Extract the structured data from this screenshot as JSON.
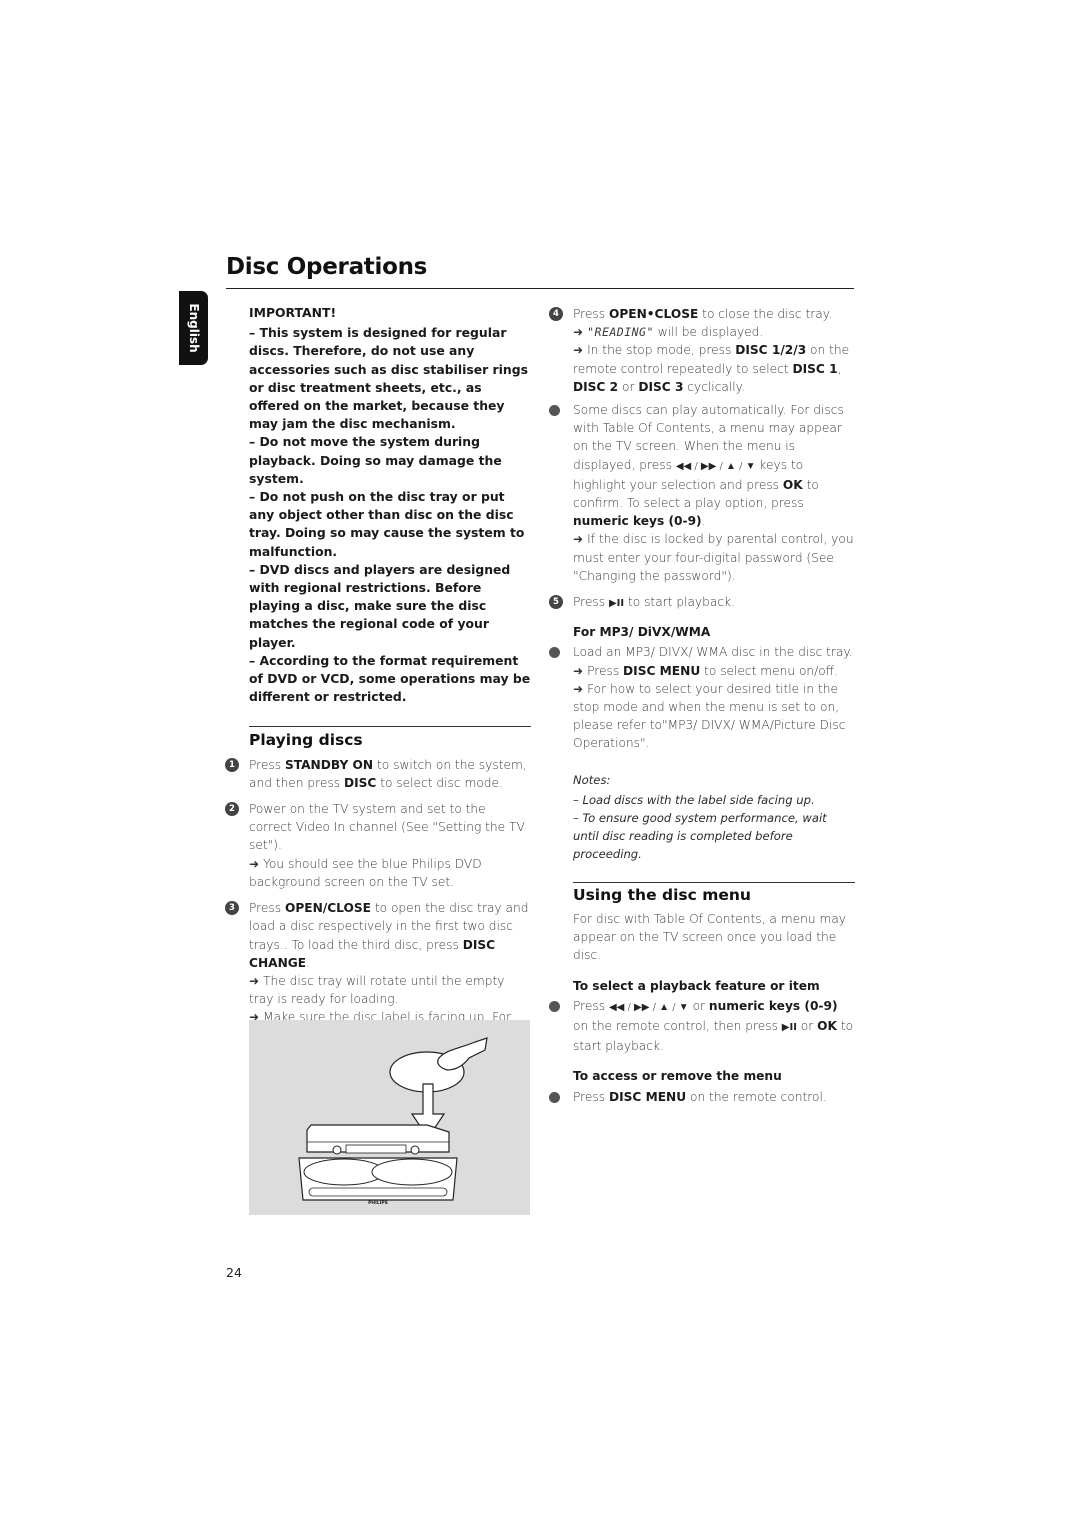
{
  "page": {
    "title": "Disc Operations",
    "language_tab": "English",
    "page_number": "24"
  },
  "important": {
    "title": "IMPORTANT!",
    "items": [
      "–  This system is designed for regular discs. Therefore, do not use any accessories such as disc stabiliser rings or disc treatment sheets, etc., as offered on the market, because they may jam the disc mechanism.",
      "–  Do not move the system during playback. Doing so may damage the system.",
      "–  Do not push on the disc tray or put any object other than disc on the disc tray. Doing so may cause the system to malfunction.",
      "–  DVD discs and players are designed with regional restrictions. Before playing a disc, make sure the disc matches the regional code of your player.",
      "–  According to the format requirement of DVD or VCD, some operations may be different or restricted."
    ]
  },
  "playing_discs": {
    "heading": "Playing discs",
    "step1": {
      "num": "1",
      "t1": "Press ",
      "b1": "STANDBY ON",
      "t2": " to switch on the system, and then press ",
      "b2": "DISC",
      "t3": " to select disc mode."
    },
    "step2": {
      "num": "2",
      "t1": "Power on the TV system and set to the correct Video In channel (See \"Setting the TV set\").",
      "arrow": "➜",
      "t2": " You should see the blue Philips DVD background screen on the TV set."
    },
    "step3": {
      "num": "3",
      "t1": "Press ",
      "b1": "OPEN/CLOSE",
      "t2": " to open the disc tray and load a disc respectively in the first two disc trays.. To load the third disc, press ",
      "b2": "DISC CHANGE",
      "t3": ".",
      "arrow": "➜",
      "t4": " The disc tray will rotate until the empty tray is ready for loading.",
      "t5": " Make sure the disc label is facing up. For double-sided discs, load the side you want to play facing down."
    },
    "illustration": {
      "brand": "PHILIPS",
      "icon": "disc-loading-illustration"
    },
    "step4": {
      "num": "4",
      "t1": "Press ",
      "b1": "OPEN•CLOSE",
      "t2": " to close the disc tray.",
      "arrow": "➜",
      "lcd": "\"READING\"",
      "t3": " will be displayed.",
      "t4": " In the stop mode, press ",
      "b2": "DISC 1/2/3",
      "t5": " on the remote control repeatedly to select ",
      "b3": "DISC 1",
      "t6": ", ",
      "b4": "DISC 2",
      "t7": " or ",
      "b5": "DISC 3",
      "t8": " cyclically."
    },
    "auto_play": {
      "t1": "Some discs can play automatically. For discs with Table Of Contents, a menu may appear on the TV screen. When the menu is displayed, press ",
      "keys": "◀◀ / ▶▶ / ▲ / ▼",
      "t2": " keys to highlight your selection and press ",
      "b1": "OK",
      "t3": " to confirm. To select a play option, press ",
      "b2": "numeric keys (0-9)",
      "t4": ".",
      "arrow": "➜",
      "t5": " If the disc is locked by parental control, you must enter your four-digital password (See \"Changing the password\")."
    },
    "step5": {
      "num": "5",
      "t1": "Press ",
      "key": "▶II",
      "t2": " to start playback."
    }
  },
  "mp3": {
    "subhead": "For MP3/ DiVX/WMA",
    "t1": "Load an MP3/ DIVX/ WMA disc in the disc tray.",
    "arrow": "➜",
    "t2": " Press ",
    "b1": "DISC MENU",
    "t3": " to select menu on/off.",
    "t4": " For how to select your desired title in the stop mode and when the menu is set to on, please refer to\"MP3/ DIVX/ WMA/Picture Disc Operations\"."
  },
  "notes": {
    "title": "Notes:",
    "items": [
      "–  Load discs with the label side facing up.",
      "–  To ensure good system performance, wait until disc reading is completed before proceeding."
    ]
  },
  "disc_menu": {
    "heading": "Using the disc menu",
    "intro": "For disc with Table Of Contents, a menu may appear on the TV screen once you load the disc.",
    "select": {
      "subhead": "To select a playback feature or item",
      "t1": "Press ",
      "keys": "◀◀ / ▶▶  / ▲ / ▼",
      "t2": " or ",
      "b1": "numeric keys (0-9)",
      "t3": " on the remote control, then press ",
      "key": "▶II",
      "t4": " or ",
      "b2": "OK",
      "t5": " to start playback."
    },
    "access": {
      "subhead": "To access or remove the menu",
      "t1": "Press ",
      "b1": "DISC MENU",
      "t2": " on the remote control."
    }
  }
}
